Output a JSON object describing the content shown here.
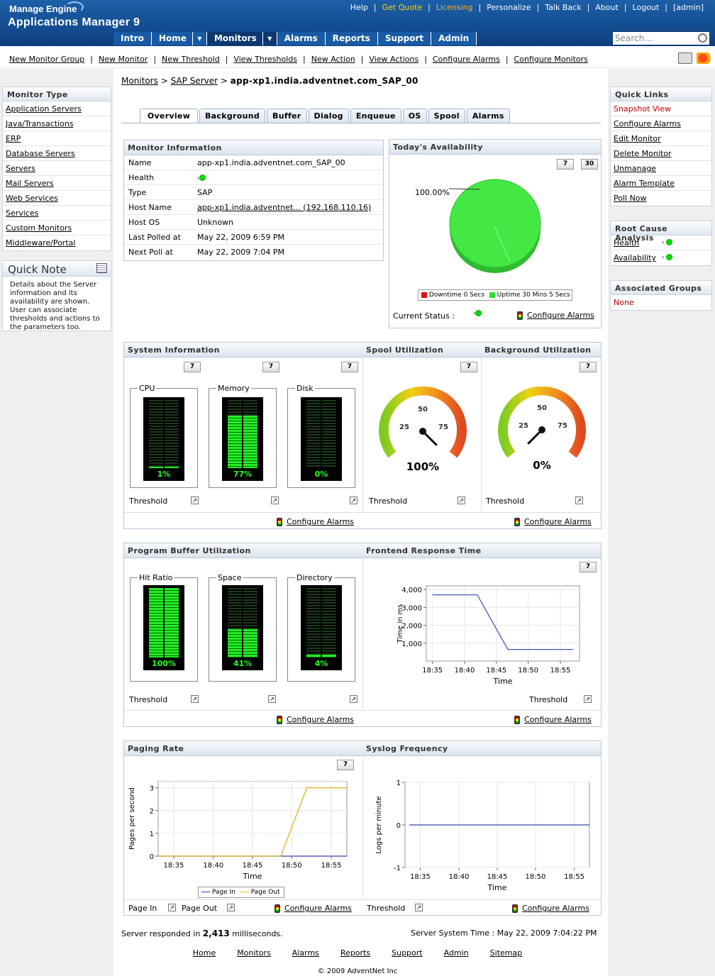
{
  "header": {
    "brand_top": "Manage Engine",
    "brand_product": "Applications Manager 9",
    "top_links": [
      "Help",
      "Get Quote",
      "Licensing",
      "Personalize",
      "Talk Back",
      "About",
      "Logout",
      "[admin]"
    ],
    "search_placeholder": "Search..."
  },
  "main_nav": [
    "Intro",
    "Home",
    "Monitors",
    "Alarms",
    "Reports",
    "Support",
    "Admin"
  ],
  "sub_nav": [
    "New Monitor Group",
    "New Monitor",
    "New Threshold",
    "View Thresholds",
    "New Action",
    "View Actions",
    "Configure Alarms",
    "Configure Monitors"
  ],
  "left": {
    "monitor_type_title": "Monitor Type",
    "monitor_types": [
      "Application Servers",
      "Java/Transactions",
      "ERP",
      "Database Servers",
      "Servers",
      "Mail Servers",
      "Web Services",
      "Services",
      "Custom Monitors",
      "Middleware/Portal"
    ],
    "quick_note_title": "Quick Note",
    "quick_note_text": "Details about the Server information and its availability are shown. User can associate thresholds and actions to the parameters too."
  },
  "right": {
    "quick_links_title": "Quick Links",
    "quick_links": [
      "Snapshot View",
      "Configure Alarms",
      "Edit Monitor",
      "Delete Monitor",
      "Unmanage",
      "Alarm Template",
      "Poll Now"
    ],
    "rca_title": "Root Cause Analysis",
    "rca_items": [
      "Health",
      "Availability"
    ],
    "groups_title": "Associated Groups",
    "groups_value": "None"
  },
  "breadcrumb": {
    "l1": "Monitors",
    "sep": ">",
    "l2": "SAP Server",
    "current": "app-xp1.india.adventnet.com_SAP_00"
  },
  "tabs": [
    "Overview",
    "Background",
    "Buffer",
    "Dialog",
    "Enqueue",
    "OS",
    "Spool",
    "Alarms"
  ],
  "monitor_info": {
    "title": "Monitor Information",
    "rows": [
      {
        "k": "Name",
        "v": "app-xp1.india.adventnet.com_SAP_00"
      },
      {
        "k": "Health",
        "v": ""
      },
      {
        "k": "Type",
        "v": "SAP"
      },
      {
        "k": "Host Name",
        "v": "app-xp1.india.adventnet... (192.168.110.16)"
      },
      {
        "k": "Host OS",
        "v": "Unknown"
      },
      {
        "k": "Last Polled at",
        "v": "May 22, 2009 6:59 PM"
      },
      {
        "k": "Next Poll at",
        "v": "May 22, 2009 7:04 PM"
      }
    ]
  },
  "availability": {
    "title": "Today's Availability",
    "btn7": "7",
    "btn30": "30",
    "pct_label": "100.00%",
    "legend_down": "Downtime 0 Secs",
    "legend_up": "Uptime 30 Mins 5 Secs",
    "status_label": "Current Status :",
    "configure": "Configure Alarms",
    "up_color": "#33dd33",
    "down_color": "#dd1111"
  },
  "system_info": {
    "title": "System Information",
    "spool_title": "Spool Utilization",
    "bg_title": "Background Utilization",
    "meters": [
      {
        "label": "CPU",
        "pct": 1,
        "text": "1%"
      },
      {
        "label": "Memory",
        "pct": 77,
        "text": "77%"
      },
      {
        "label": "Disk",
        "pct": 0,
        "text": "0%"
      }
    ],
    "spool_value": 100,
    "spool_text": "100%",
    "bg_value": 0,
    "bg_text": "0%",
    "gauge_ticks": [
      "25",
      "50",
      "75"
    ],
    "threshold": "Threshold",
    "configure": "Configure Alarms",
    "btn7": "7"
  },
  "buffer": {
    "title": "Program Buffer Utilization",
    "frontend_title": "Frontend Response Time",
    "meters": [
      {
        "label": "Hit Ratio",
        "pct": 100,
        "text": "100%"
      },
      {
        "label": "Space",
        "pct": 41,
        "text": "41%"
      },
      {
        "label": "Directory",
        "pct": 4,
        "text": "4%"
      }
    ],
    "threshold": "Threshold",
    "configure": "Configure Alarms",
    "btn7": "7"
  },
  "paging": {
    "title": "Paging Rate",
    "syslog_title": "Syslog Frequency",
    "page_in": "Page In",
    "page_out": "Page Out",
    "threshold": "Threshold",
    "configure": "Configure Alarms",
    "btn7": "7"
  },
  "chart_data": [
    {
      "type": "line",
      "title": "Frontend Response Time",
      "xlabel": "Time",
      "ylabel": "Time in ms",
      "x": [
        "18:35",
        "18:40",
        "18:45",
        "18:50",
        "18:55"
      ],
      "xnum": [
        18.583,
        18.667,
        18.75,
        18.833,
        18.917
      ],
      "series": [
        {
          "name": "",
          "x": [
            18.583,
            18.7,
            18.78,
            18.95
          ],
          "y": [
            3700,
            3700,
            650,
            650
          ],
          "color": "#4455bb"
        }
      ],
      "yticks": [
        "1,000",
        "2,000",
        "3,000",
        "4,000"
      ],
      "ylim": [
        0,
        4200
      ],
      "xlim": [
        18.567,
        18.967
      ]
    },
    {
      "type": "line",
      "title": "Paging Rate",
      "xlabel": "Time",
      "ylabel": "Pages per second",
      "x": [
        "18:35",
        "18:40",
        "18:45",
        "18:50",
        "18:55"
      ],
      "series": [
        {
          "name": "Page In",
          "x": [
            18.55,
            18.95
          ],
          "y": [
            0,
            0
          ],
          "color": "#3344aa"
        },
        {
          "name": "Page Out",
          "x": [
            18.55,
            18.81,
            18.865,
            18.95
          ],
          "y": [
            0,
            0,
            3,
            3
          ],
          "color": "#e0b020"
        }
      ],
      "yticks": [
        "0",
        "1",
        "2",
        "3"
      ],
      "ylim": [
        0,
        3.3
      ],
      "xlim": [
        18.55,
        18.95
      ]
    },
    {
      "type": "line",
      "title": "Syslog Frequency",
      "xlabel": "Time",
      "ylabel": "Logs per minute",
      "x": [
        "18:35",
        "18:40",
        "18:45",
        "18:50",
        "18:55"
      ],
      "series": [
        {
          "name": "",
          "x": [
            18.56,
            18.95
          ],
          "y": [
            0,
            0
          ],
          "color": "#3344aa"
        }
      ],
      "yticks": [
        "-1",
        "0",
        "1"
      ],
      "ylim": [
        -1,
        1
      ],
      "xlim": [
        18.55,
        18.95
      ]
    },
    {
      "type": "pie",
      "title": "Today's Availability",
      "categories": [
        "Downtime 0 Secs",
        "Uptime 30 Mins 5 Secs"
      ],
      "values": [
        0,
        100
      ]
    }
  ],
  "footer": {
    "resp_prefix": "Server responded in",
    "resp_value": "2,413",
    "resp_suffix": "milliseconds.",
    "server_time": "Server System Time : May 22, 2009 7:04:22 PM",
    "links": [
      "Home",
      "Monitors",
      "Alarms",
      "Reports",
      "Support",
      "Admin",
      "Sitemap"
    ],
    "copyright": "© 2009 AdventNet Inc"
  }
}
